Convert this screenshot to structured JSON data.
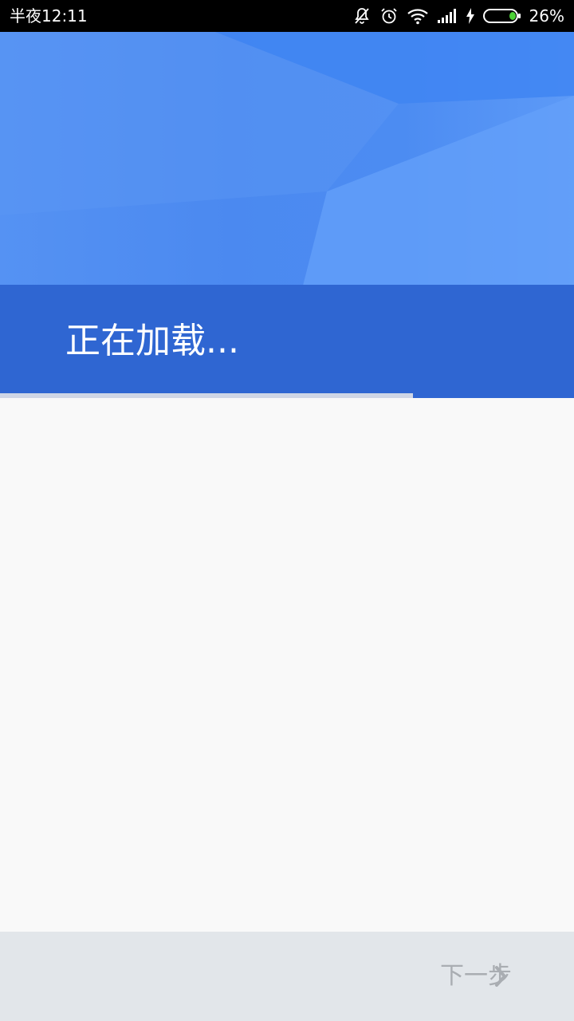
{
  "status_bar": {
    "time": "半夜12:11",
    "battery_percent": "26%",
    "battery_level": 0.26,
    "icons": [
      "notifications-off-icon",
      "alarm-icon",
      "wifi-icon",
      "signal-icon",
      "charging-icon",
      "battery-icon"
    ]
  },
  "header": {
    "title": "正在加载..."
  },
  "progress": {
    "value": 0.72
  },
  "footer": {
    "next_label": "下一步",
    "next_icon": "chevron-right-icon"
  },
  "colors": {
    "header_blue": "#4b89f0",
    "band_blue": "#2f66d2",
    "background": "#f9f9f9",
    "footer_bg": "#e2e6ea",
    "disabled_text": "#a9adb2"
  }
}
